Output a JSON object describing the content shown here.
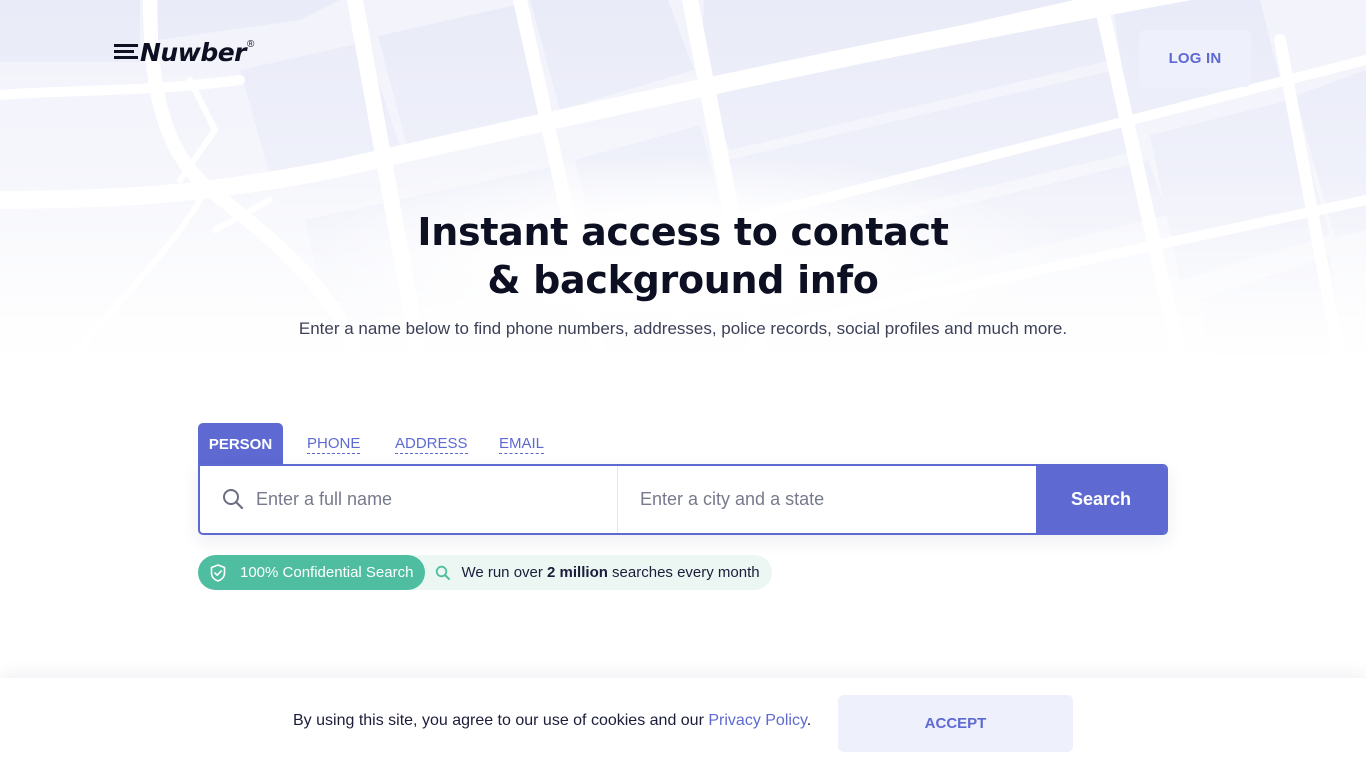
{
  "header": {
    "logo_text": "Nuwber",
    "logo_reg": "®",
    "login_label": "LOG IN"
  },
  "hero": {
    "title_line1": "Instant access to contact",
    "title_line2": "& background info",
    "subtitle": "Enter a name below to find phone numbers, addresses, police records, social profiles and much more."
  },
  "search": {
    "tabs": [
      {
        "label": "PERSON",
        "active": true
      },
      {
        "label": "PHONE",
        "active": false
      },
      {
        "label": "ADDRESS",
        "active": false
      },
      {
        "label": "EMAIL",
        "active": false
      }
    ],
    "name_placeholder": "Enter a full name",
    "city_placeholder": "Enter a city and a state",
    "button_label": "Search"
  },
  "badges": {
    "confidential": "100% Confidential Search",
    "stats_prefix": "We run over ",
    "stats_bold": "2 million",
    "stats_suffix": " searches every month"
  },
  "cookie": {
    "text": "By using this site, you agree to our use of cookies and our ",
    "link": "Privacy Policy",
    "suffix": ".",
    "accept_label": "ACCEPT"
  },
  "colors": {
    "accent": "#5e6ad2",
    "heading": "#0d0f22",
    "badge_green": "#4fbea0",
    "badge_light": "#ecf7f3",
    "button_light": "#eef0fb"
  },
  "icons": {
    "search_field": "search-icon",
    "confidential": "shield-check-icon",
    "stats": "search-icon"
  }
}
